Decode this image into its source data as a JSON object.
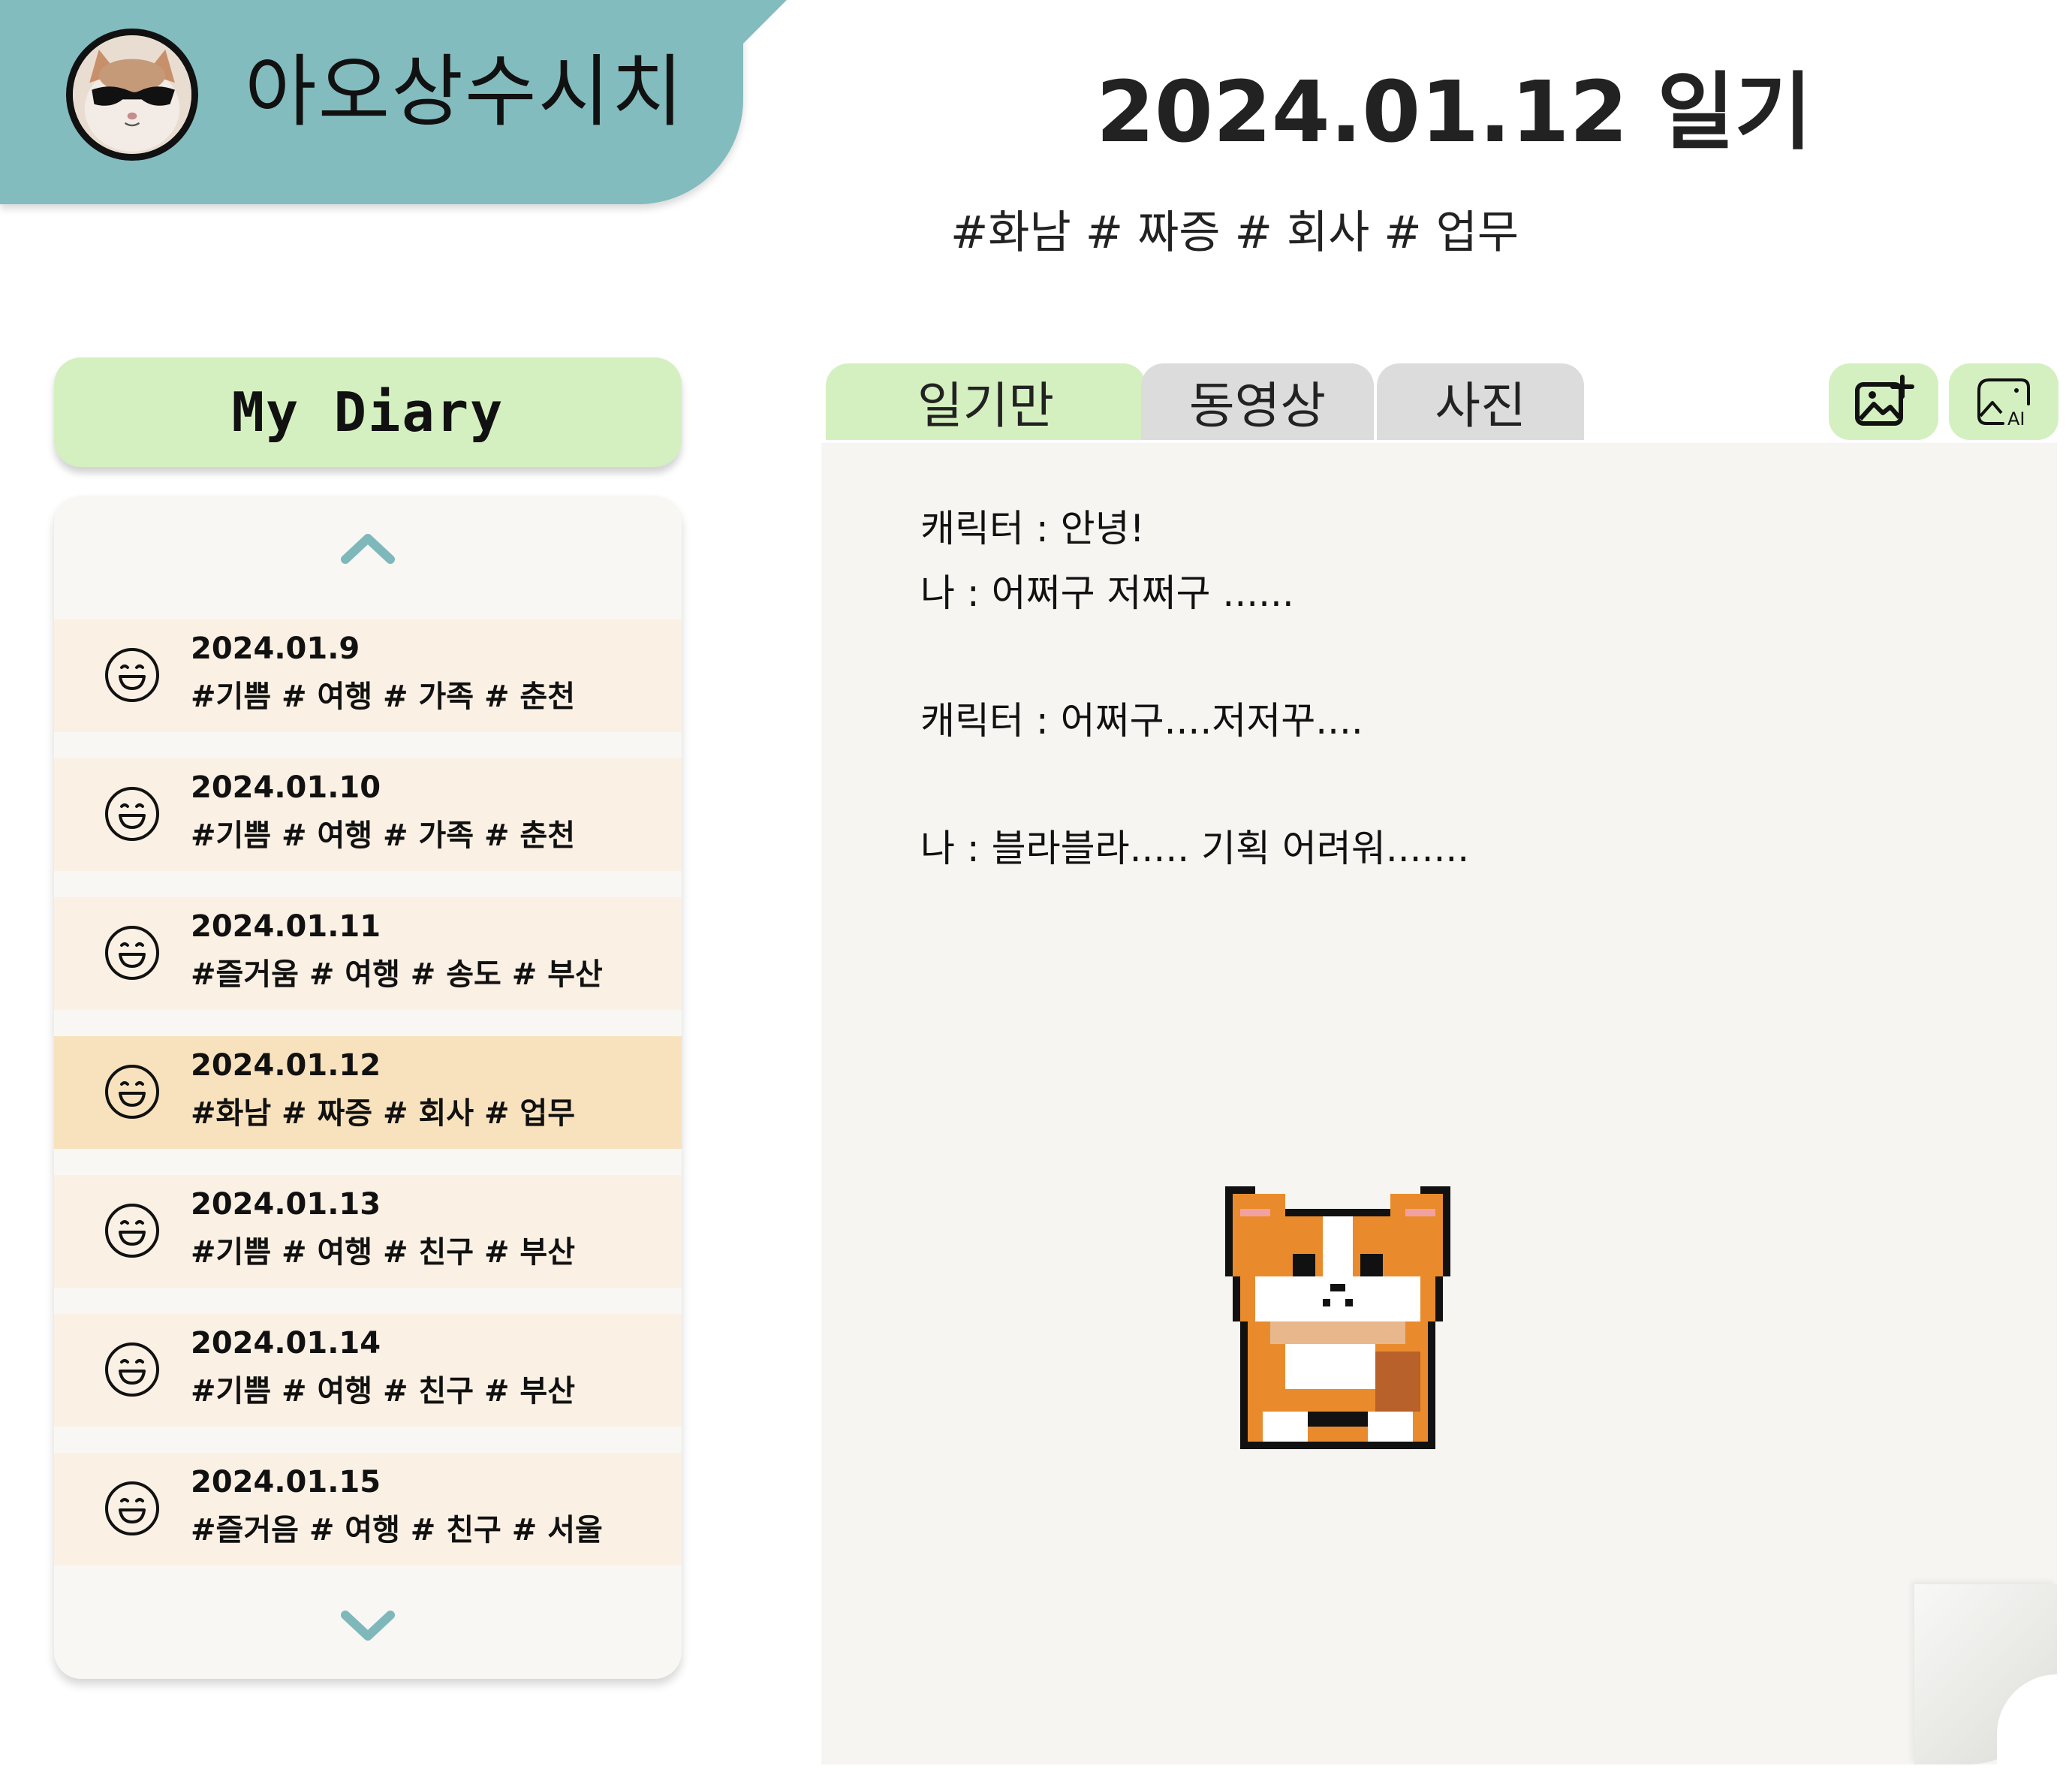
{
  "profile": {
    "username": "아오상수시치"
  },
  "page": {
    "title": "2024.01.12 일기",
    "tags": "#화남 # 짜증 # 회사 # 업무"
  },
  "sidebar": {
    "my_diary_label": "My Diary",
    "entries": [
      {
        "date": "2024.01.9",
        "tags": "#기쁨 # 여행 # 가족 # 춘천"
      },
      {
        "date": "2024.01.10",
        "tags": "#기쁨 # 여행 # 가족 # 춘천"
      },
      {
        "date": "2024.01.11",
        "tags": "#즐거움 # 여행 # 송도 # 부산"
      },
      {
        "date": "2024.01.12",
        "tags": "#화남 # 짜증 # 회사 # 업무"
      },
      {
        "date": "2024.01.13",
        "tags": "#기쁨 # 여행 # 친구 # 부산"
      },
      {
        "date": "2024.01.14",
        "tags": "#기쁨 # 여행 # 친구 # 부산"
      },
      {
        "date": "2024.01.15",
        "tags": "#즐거음 # 여행 # 친구 # 서울"
      }
    ],
    "selected_entry": "2024.01.12"
  },
  "tabs": [
    {
      "label": "일기만",
      "active": true
    },
    {
      "label": "동영상",
      "active": false
    },
    {
      "label": "사진",
      "active": false
    }
  ],
  "toolbar": {
    "add_image_icon": "image-plus-icon",
    "ai_image_icon": "ai-image-icon",
    "ai_label": "AI"
  },
  "content": {
    "lines": [
      "캐릭터 : 안녕!",
      "나 : 어쩌구 저쩌구 ......",
      "캐릭터 : 어쩌구....저저꾸....",
      "나 : 블라블라..... 기획 어려워......."
    ]
  },
  "colors": {
    "header_teal": "#82bcbe",
    "accent_green": "#d4f0c0",
    "entry_bg": "#faf0e4",
    "entry_selected_bg": "#f8e2bd",
    "tab_inactive": "#dcdcdc",
    "content_bg": "#f6f5f2"
  }
}
